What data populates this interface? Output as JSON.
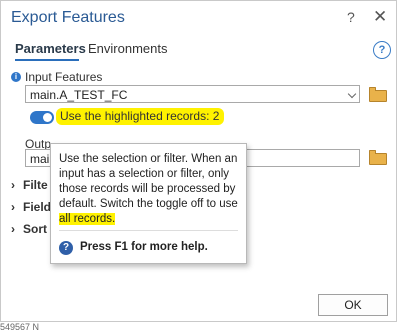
{
  "dialog": {
    "title": "Export Features",
    "help_glyph": "?",
    "close_glyph": "✕"
  },
  "tabs": [
    {
      "label": "Parameters",
      "active": true
    },
    {
      "label": "Environments",
      "active": false
    }
  ],
  "help_icon": {
    "glyph": "?",
    "icon": "help-circle-icon"
  },
  "input_features": {
    "label": "Input Features",
    "value": "main.A_TEST_FC",
    "info_glyph": "i"
  },
  "toggle": {
    "state": "on",
    "label": "Use the highlighted records: 2"
  },
  "output": {
    "label": "Outp",
    "value": "main"
  },
  "sections": [
    {
      "label": "Filte",
      "arrow": "›"
    },
    {
      "label": "Field",
      "arrow": "›"
    },
    {
      "label": "Sort",
      "arrow": "›"
    }
  ],
  "tooltip": {
    "text": "Use the selection or filter. When an input has a selection or filter, only those records will be processed by default. Switch the toggle off to use ",
    "text_highlight": "all records.",
    "help_glyph": "?",
    "help_text": "Press F1 for more help."
  },
  "buttons": {
    "ok_label": "OK"
  },
  "statusbar": {
    "coordinate_fragment": "549567 N"
  },
  "colors": {
    "accent": "#2f76c9",
    "highlight": "#fff200",
    "title": "#2a5a94"
  }
}
